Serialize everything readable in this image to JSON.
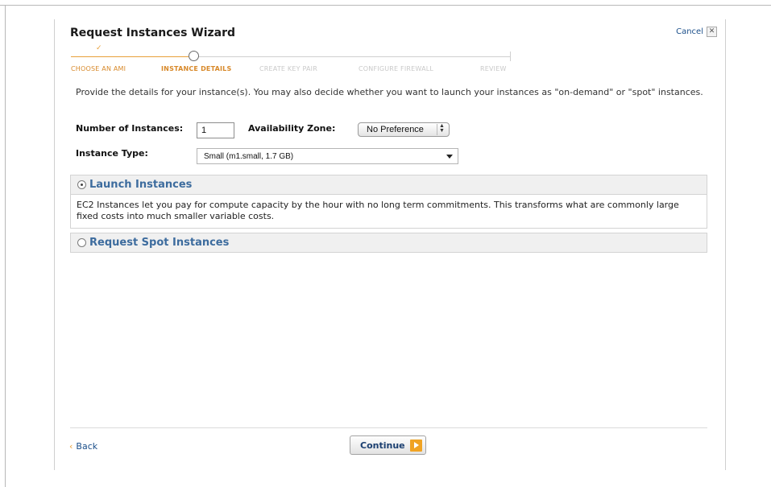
{
  "wizard": {
    "title": "Request Instances Wizard",
    "cancel_label": "Cancel",
    "cancel_icon": "close-icon"
  },
  "steps": [
    {
      "label": "CHOOSE AN AMI",
      "state": "done"
    },
    {
      "label": "INSTANCE DETAILS",
      "state": "current"
    },
    {
      "label": "CREATE KEY PAIR",
      "state": "todo"
    },
    {
      "label": "CONFIGURE FIREWALL",
      "state": "todo"
    },
    {
      "label": "REVIEW",
      "state": "todo"
    }
  ],
  "check_icon": "✓",
  "intro_text": "Provide the details for your instance(s). You may also decide whether you want to launch your instances as \"on-demand\" or \"spot\" instances.",
  "form": {
    "num_instances_label": "Number of Instances:",
    "num_instances_value": "1",
    "zone_label": "Availability Zone:",
    "zone_value": "No Preference",
    "type_label": "Instance Type:",
    "type_value": "Small (m1.small, 1.7 GB)"
  },
  "launch_panel": {
    "title": "Launch Instances",
    "selected": true,
    "description": "EC2 Instances let you pay for compute capacity by the hour with no long term commitments. This transforms what are commonly large fixed costs into much smaller variable costs."
  },
  "spot_panel": {
    "title": "Request Spot Instances",
    "selected": false
  },
  "footer": {
    "back_label": "Back",
    "continue_label": "Continue"
  },
  "colors": {
    "accent": "#e8a03a",
    "link": "#1b4f8a",
    "panel_title": "#3d6c9e"
  }
}
